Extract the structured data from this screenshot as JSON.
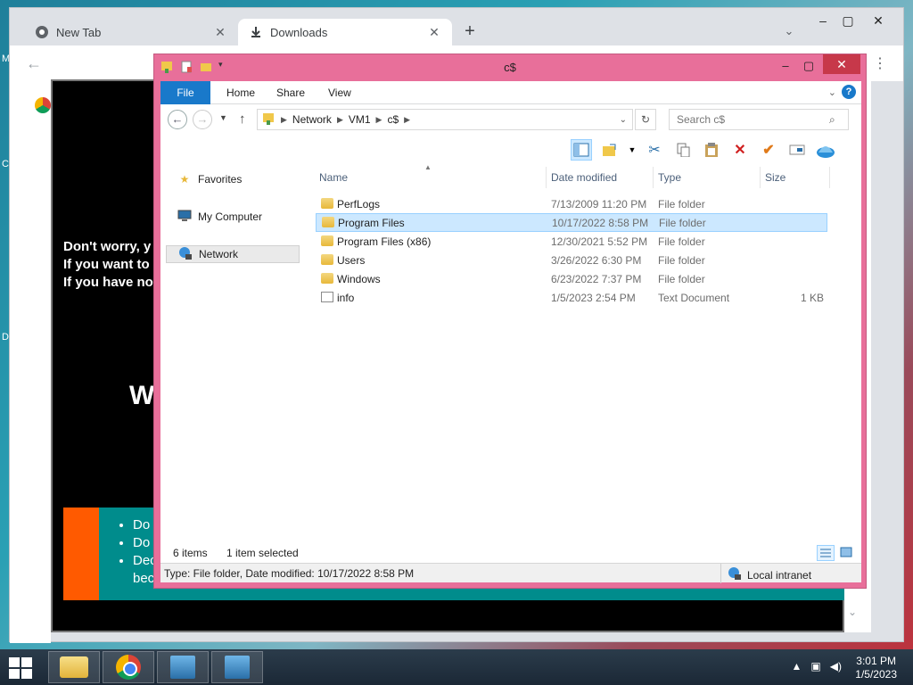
{
  "browser": {
    "tabs": [
      {
        "label": "New Tab"
      },
      {
        "label": "Downloads"
      }
    ],
    "new_tab_symbol": "+",
    "page_message_lines": [
      "Don't worry, y",
      "If you want to",
      "If you have no"
    ],
    "page_big_text": "W",
    "page_list_items": [
      "Do",
      "Do",
      "Dec",
      "bec"
    ]
  },
  "explorer": {
    "title": "c$",
    "ribbon_tabs": [
      "File",
      "Home",
      "Share",
      "View"
    ],
    "address": [
      "Network",
      "VM1",
      "c$"
    ],
    "search_placeholder": "Search c$",
    "nav_items": [
      {
        "label": "Favorites",
        "icon": "star-icon"
      },
      {
        "label": "My Computer",
        "icon": "computer-icon"
      },
      {
        "label": "Network",
        "icon": "network-icon"
      }
    ],
    "columns": [
      "Name",
      "Date modified",
      "Type",
      "Size"
    ],
    "files": [
      {
        "name": "PerfLogs",
        "date": "7/13/2009 11:20 PM",
        "type": "File folder",
        "size": "",
        "kind": "folder"
      },
      {
        "name": "Program Files",
        "date": "10/17/2022 8:58 PM",
        "type": "File folder",
        "size": "",
        "kind": "folder"
      },
      {
        "name": "Program Files (x86)",
        "date": "12/30/2021 5:52 PM",
        "type": "File folder",
        "size": "",
        "kind": "folder"
      },
      {
        "name": "Users",
        "date": "3/26/2022 6:30 PM",
        "type": "File folder",
        "size": "",
        "kind": "folder"
      },
      {
        "name": "Windows",
        "date": "6/23/2022 7:37 PM",
        "type": "File folder",
        "size": "",
        "kind": "folder"
      },
      {
        "name": "info",
        "date": "1/5/2023 2:54 PM",
        "type": "Text Document",
        "size": "1 KB",
        "kind": "doc"
      }
    ],
    "status_items": "6 items",
    "status_selected": "1 item selected",
    "details_text": "Type: File folder, Date modified: 10/17/2022 8:58 PM",
    "zone_text": "Local intranet"
  },
  "taskbar": {
    "time": "3:01 PM",
    "date": "1/5/2023"
  },
  "colors": {
    "explorer_frame": "#e86f9a",
    "accent": "#1979ca",
    "selection": "#cce8ff"
  }
}
